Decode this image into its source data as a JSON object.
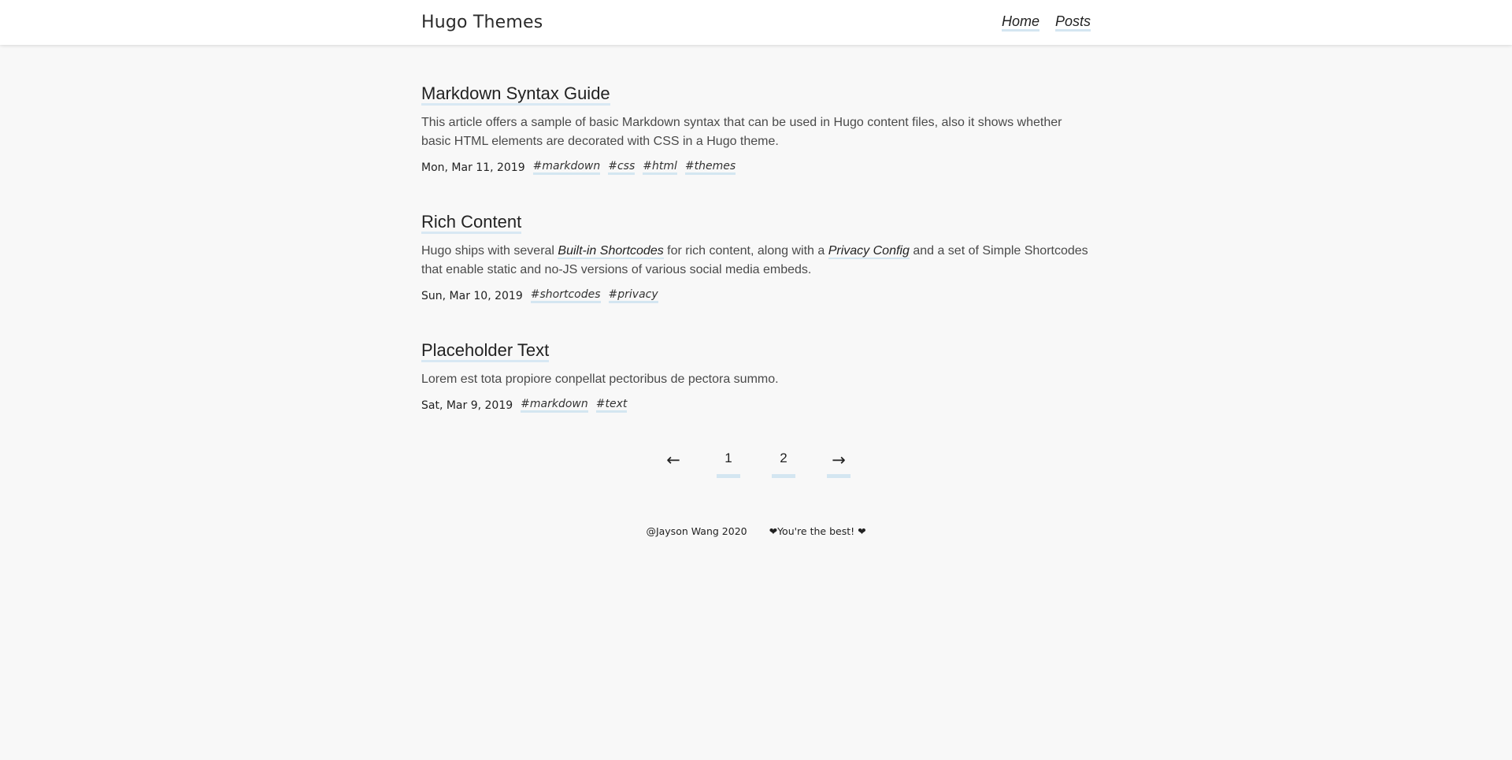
{
  "header": {
    "site_title": "Hugo Themes",
    "nav": [
      {
        "label": "Home"
      },
      {
        "label": "Posts"
      }
    ]
  },
  "posts": [
    {
      "title": "Markdown Syntax Guide",
      "summary": "This article offers a sample of basic Markdown syntax that can be used in Hugo content files, also it shows whether basic HTML elements are decorated with CSS in a Hugo theme.",
      "date": "Mon, Mar 11, 2019",
      "tags": [
        "#markdown",
        "#css",
        "#html",
        "#themes"
      ]
    },
    {
      "title": "Rich Content",
      "summary_parts": {
        "before": "Hugo ships with several ",
        "link1": "Built-in Shortcodes",
        "middle": " for rich content, along with a ",
        "link2": "Privacy Config",
        "after": " and a set of Simple Shortcodes that enable static and no-JS versions of various social media embeds."
      },
      "date": "Sun, Mar 10, 2019",
      "tags": [
        "#shortcodes",
        "#privacy"
      ]
    },
    {
      "title": "Placeholder Text",
      "summary": "Lorem est tota propiore conpellat pectoribus de pectora summo.",
      "date": "Sat, Mar 9, 2019",
      "tags": [
        "#markdown",
        "#text"
      ]
    }
  ],
  "pagination": {
    "prev": "←",
    "pages": [
      "1",
      "2"
    ],
    "next": "→"
  },
  "footer": {
    "copyright": "@Jayson Wang 2020",
    "message": "❤You're the best! ❤"
  },
  "colors": {
    "background": "#f8f8f8",
    "header_bg": "#ffffff",
    "underline_accent": "#d4e6f1",
    "text": "#222222"
  }
}
